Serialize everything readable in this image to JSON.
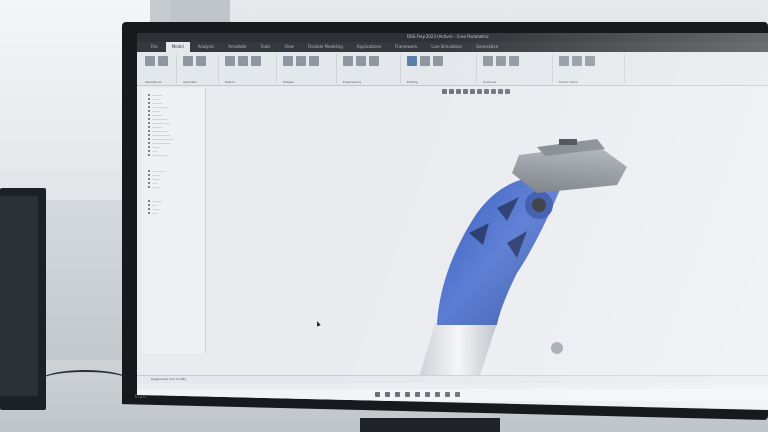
{
  "window": {
    "title": "DSS-Frey.2023 (Active) - Creo Parametric"
  },
  "ribbon": {
    "tabs": [
      "File",
      "Model",
      "Analysis",
      "Annotate",
      "Tools",
      "View",
      "Flexible Modeling",
      "Applications",
      "Framework",
      "Live Simulation",
      "Generative"
    ],
    "groups": [
      {
        "label": "Operations"
      },
      {
        "label": "Get Data"
      },
      {
        "label": "Datum"
      },
      {
        "label": "Shapes"
      },
      {
        "label": "Engineering"
      },
      {
        "label": "Editing"
      },
      {
        "label": "Surfaces"
      },
      {
        "label": "Model Intent"
      }
    ]
  },
  "status": {
    "text": "Regenerate and modify"
  },
  "brand": {
    "text": "EIZO"
  },
  "colors": {
    "part_blue": "#2f56b8",
    "part_grey": "#8a9096",
    "ui_dark": "#2f3134",
    "ui_light": "#e4e7eb"
  }
}
